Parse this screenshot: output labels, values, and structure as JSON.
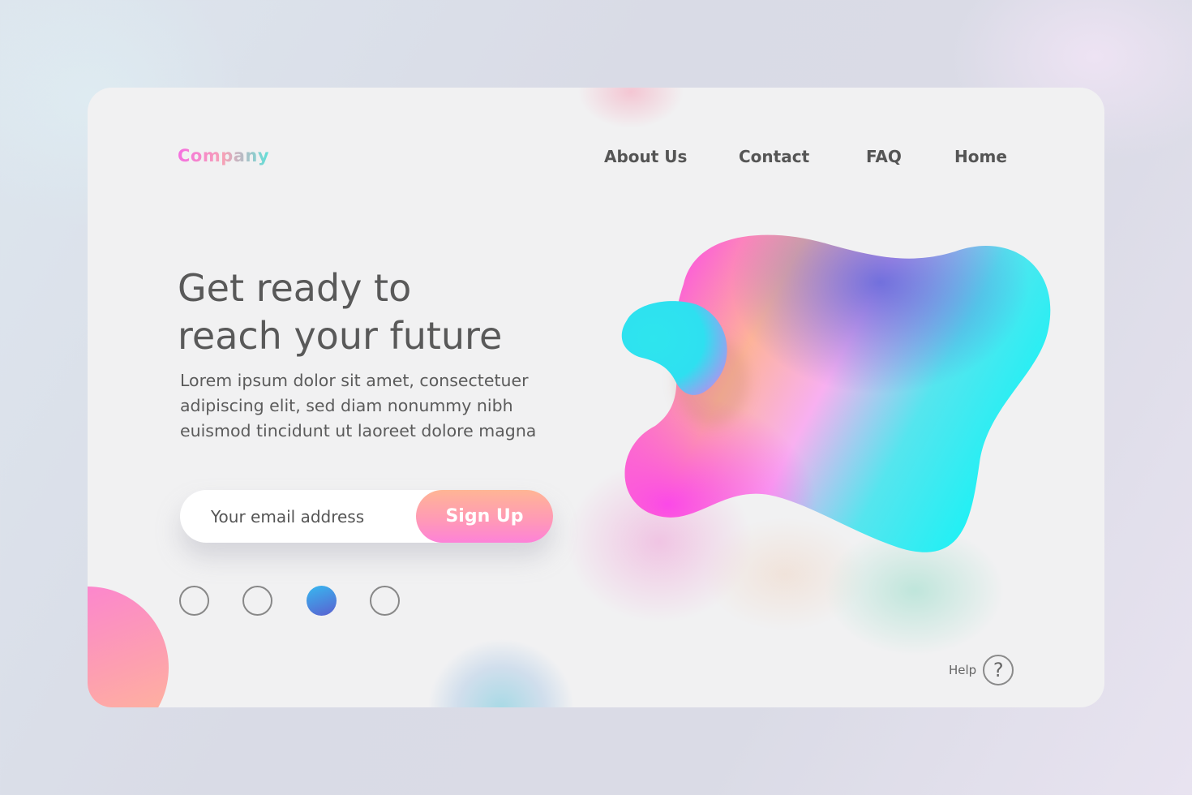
{
  "brand": {
    "logo_text": "Company"
  },
  "nav": {
    "items": [
      {
        "label": "About Us"
      },
      {
        "label": "Contact"
      },
      {
        "label": "FAQ"
      },
      {
        "label": "Home"
      }
    ]
  },
  "hero": {
    "headline_line1": "Get ready to",
    "headline_line2": "reach your future",
    "body_line1": "Lorem ipsum dolor sit amet, consectetuer",
    "body_line2": "adipiscing elit, sed diam nonummy nibh",
    "body_line3": "euismod tincidunt ut laoreet dolore magna"
  },
  "signup": {
    "email_placeholder": "Your email address",
    "email_value": "",
    "button_label": "Sign Up"
  },
  "pagination": {
    "total": 4,
    "active_index": 2
  },
  "help": {
    "label": "Help",
    "icon_glyph": "?"
  },
  "colors": {
    "text_primary": "#555555",
    "accent_pink": "#fd82d8",
    "accent_peach": "#ffb595",
    "accent_cyan": "#19f0f5",
    "active_dot_start": "#37b9f0",
    "active_dot_end": "#5a5fd0",
    "card_bg": "#f1f1f2"
  }
}
